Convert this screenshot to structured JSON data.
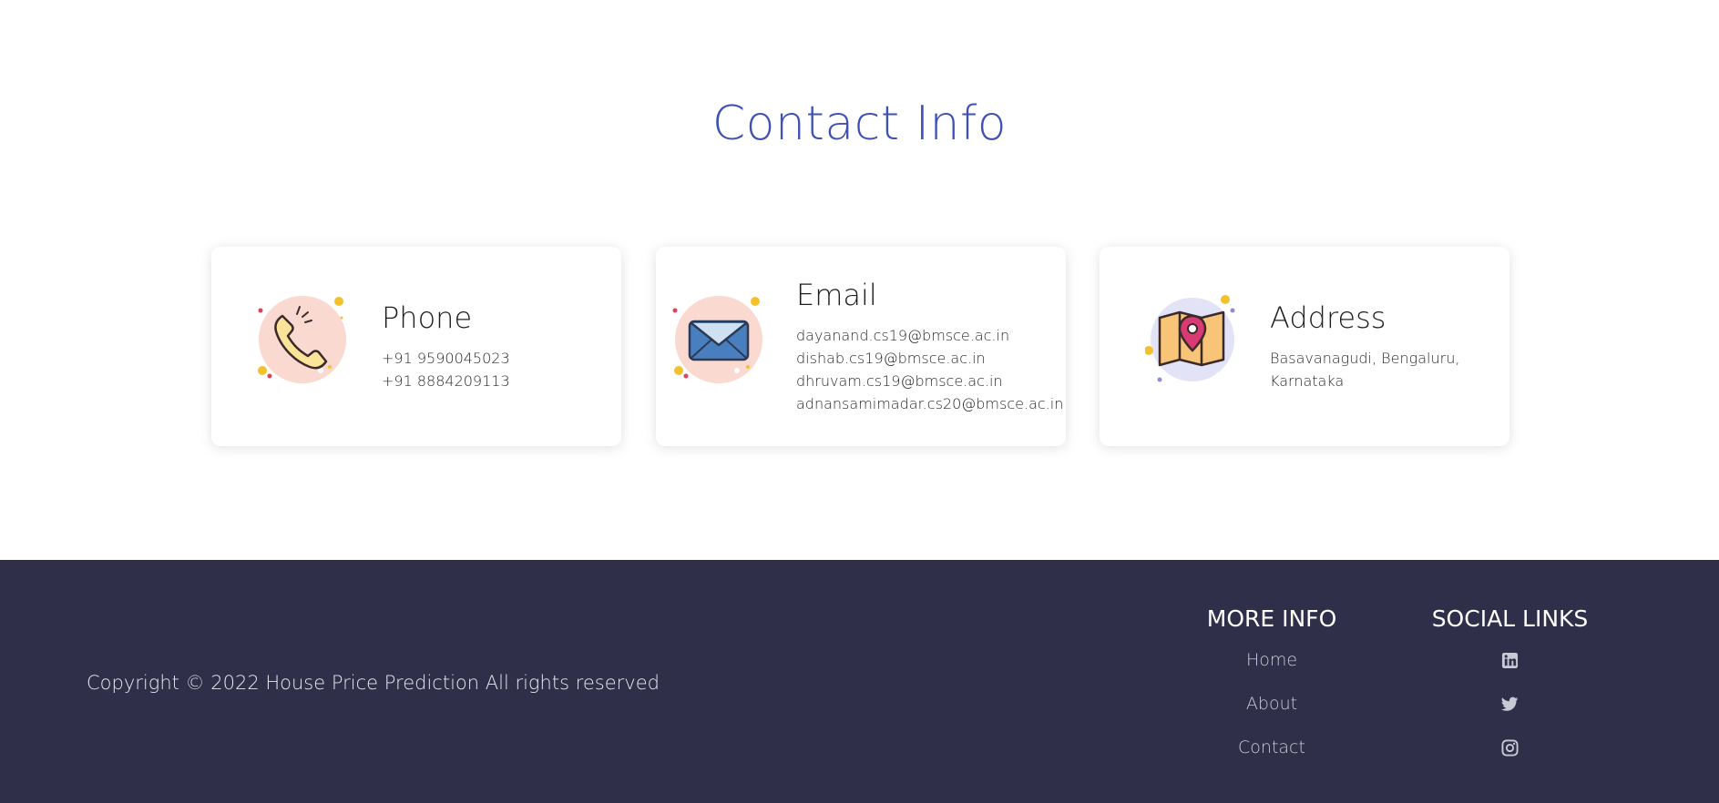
{
  "contact": {
    "title": "Contact Info",
    "cards": [
      {
        "title": "Phone",
        "lines": [
          "+91 9590045023",
          "+91 8884209113"
        ],
        "icon": "phone-icon"
      },
      {
        "title": "Email",
        "lines": [
          "dayanand.cs19@bmsce.ac.in",
          "dishab.cs19@bmsce.ac.in",
          "dhruvam.cs19@bmsce.ac.in",
          "adnansamimadar.cs20@bmsce.ac.in"
        ],
        "icon": "envelope-icon"
      },
      {
        "title": "Address",
        "lines": [
          "Basavanagudi, Bengaluru,",
          "Karnataka"
        ],
        "icon": "map-pin-icon"
      }
    ]
  },
  "footer": {
    "copyright": "Copyright © 2022 House Price Prediction All rights reserved",
    "more_info": {
      "title": "MORE INFO",
      "links": [
        "Home",
        "About",
        "Contact"
      ]
    },
    "social": {
      "title": "SOCIAL LINKS",
      "icons": [
        "linkedin-icon",
        "twitter-icon",
        "instagram-icon"
      ]
    }
  },
  "colors": {
    "accent": "#3f51b5",
    "footer_bg": "#302f4a"
  }
}
